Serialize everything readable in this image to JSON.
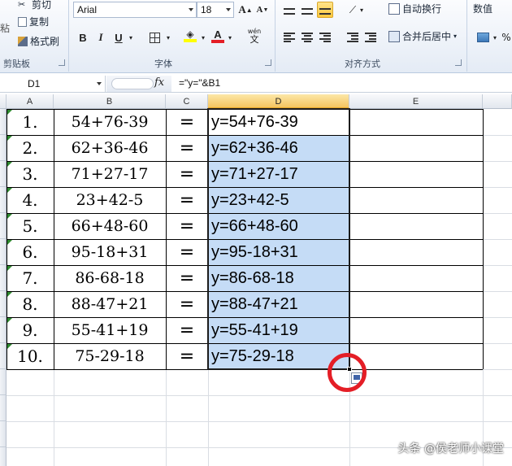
{
  "ribbon": {
    "clipboard": {
      "cut": "剪切",
      "copy": "复制",
      "format_painter": "格式刷",
      "paste": "粘",
      "group_label": "剪贴板"
    },
    "font": {
      "family": "Arial",
      "size": "18",
      "bold": "B",
      "italic": "I",
      "underline": "U",
      "grow": "A",
      "shrink": "A",
      "phonetic": "wén",
      "group_label": "字体"
    },
    "alignment": {
      "wrap_text": "自动换行",
      "merge_center": "合并后居中",
      "group_label": "对齐方式"
    },
    "number": {
      "format": "数值"
    }
  },
  "formula_bar": {
    "name_box": "D1",
    "fx": "fx",
    "formula": "=\"y=\"&B1"
  },
  "columns": [
    "A",
    "B",
    "C",
    "D",
    "E"
  ],
  "rows": [
    {
      "a": "1.",
      "b": "54+76-39",
      "c": "=",
      "d": "y=54+76-39"
    },
    {
      "a": "2.",
      "b": "62+36-46",
      "c": "=",
      "d": "y=62+36-46"
    },
    {
      "a": "3.",
      "b": "71+27-17",
      "c": "=",
      "d": "y=71+27-17"
    },
    {
      "a": "4.",
      "b": "23+42-5",
      "c": "=",
      "d": "y=23+42-5"
    },
    {
      "a": "5.",
      "b": "66+48-60",
      "c": "=",
      "d": "y=66+48-60"
    },
    {
      "a": "6.",
      "b": "95-18+31",
      "c": "=",
      "d": "y=95-18+31"
    },
    {
      "a": "7.",
      "b": "86-68-18",
      "c": "=",
      "d": "y=86-68-18"
    },
    {
      "a": "8.",
      "b": "88-47+21",
      "c": "=",
      "d": "y=88-47+21"
    },
    {
      "a": "9.",
      "b": "55-41+19",
      "c": "=",
      "d": "y=55-41+19"
    },
    {
      "a": "10.",
      "b": "75-29-18",
      "c": "=",
      "d": "y=75-29-18"
    }
  ],
  "watermark": "头条 @侯老师小课堂",
  "colors": {
    "selection": "#c5dcf6",
    "highlight_circle": "#e41e26",
    "selected_header": "#f5c560"
  }
}
